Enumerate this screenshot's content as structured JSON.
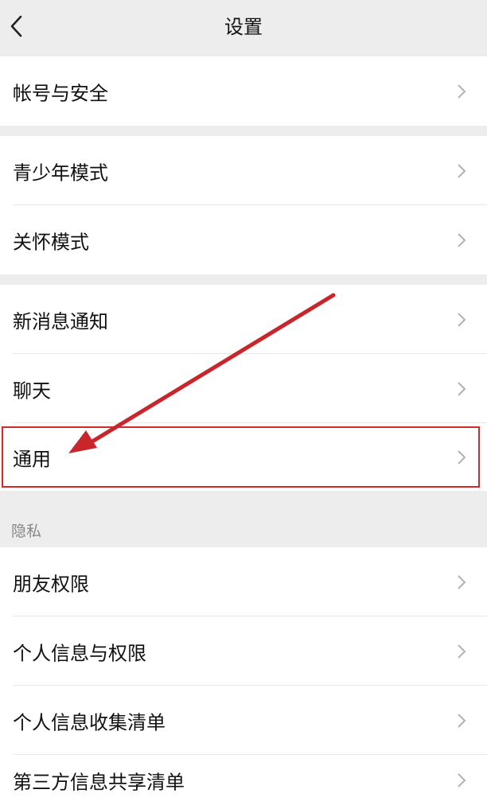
{
  "header": {
    "title": "设置",
    "back_icon": "chevron-left-icon"
  },
  "groups": [
    {
      "items": [
        {
          "label": "帐号与安全"
        }
      ]
    },
    {
      "items": [
        {
          "label": "青少年模式"
        },
        {
          "label": "关怀模式"
        }
      ]
    },
    {
      "items": [
        {
          "label": "新消息通知"
        },
        {
          "label": "聊天"
        },
        {
          "label": "通用",
          "highlighted": true
        }
      ]
    },
    {
      "section_title": "隐私",
      "items": [
        {
          "label": "朋友权限"
        },
        {
          "label": "个人信息与权限"
        },
        {
          "label": "个人信息收集清单"
        },
        {
          "label": "第三方信息共享清单"
        }
      ]
    }
  ],
  "annotation": {
    "type": "arrow",
    "color": "#c8262b",
    "target": "通用"
  },
  "colors": {
    "background": "#ededed",
    "surface": "#ffffff",
    "text": "#111111",
    "muted_text": "#888888",
    "chevron": "#b2b2b2",
    "highlight_border": "#d22a2a"
  }
}
